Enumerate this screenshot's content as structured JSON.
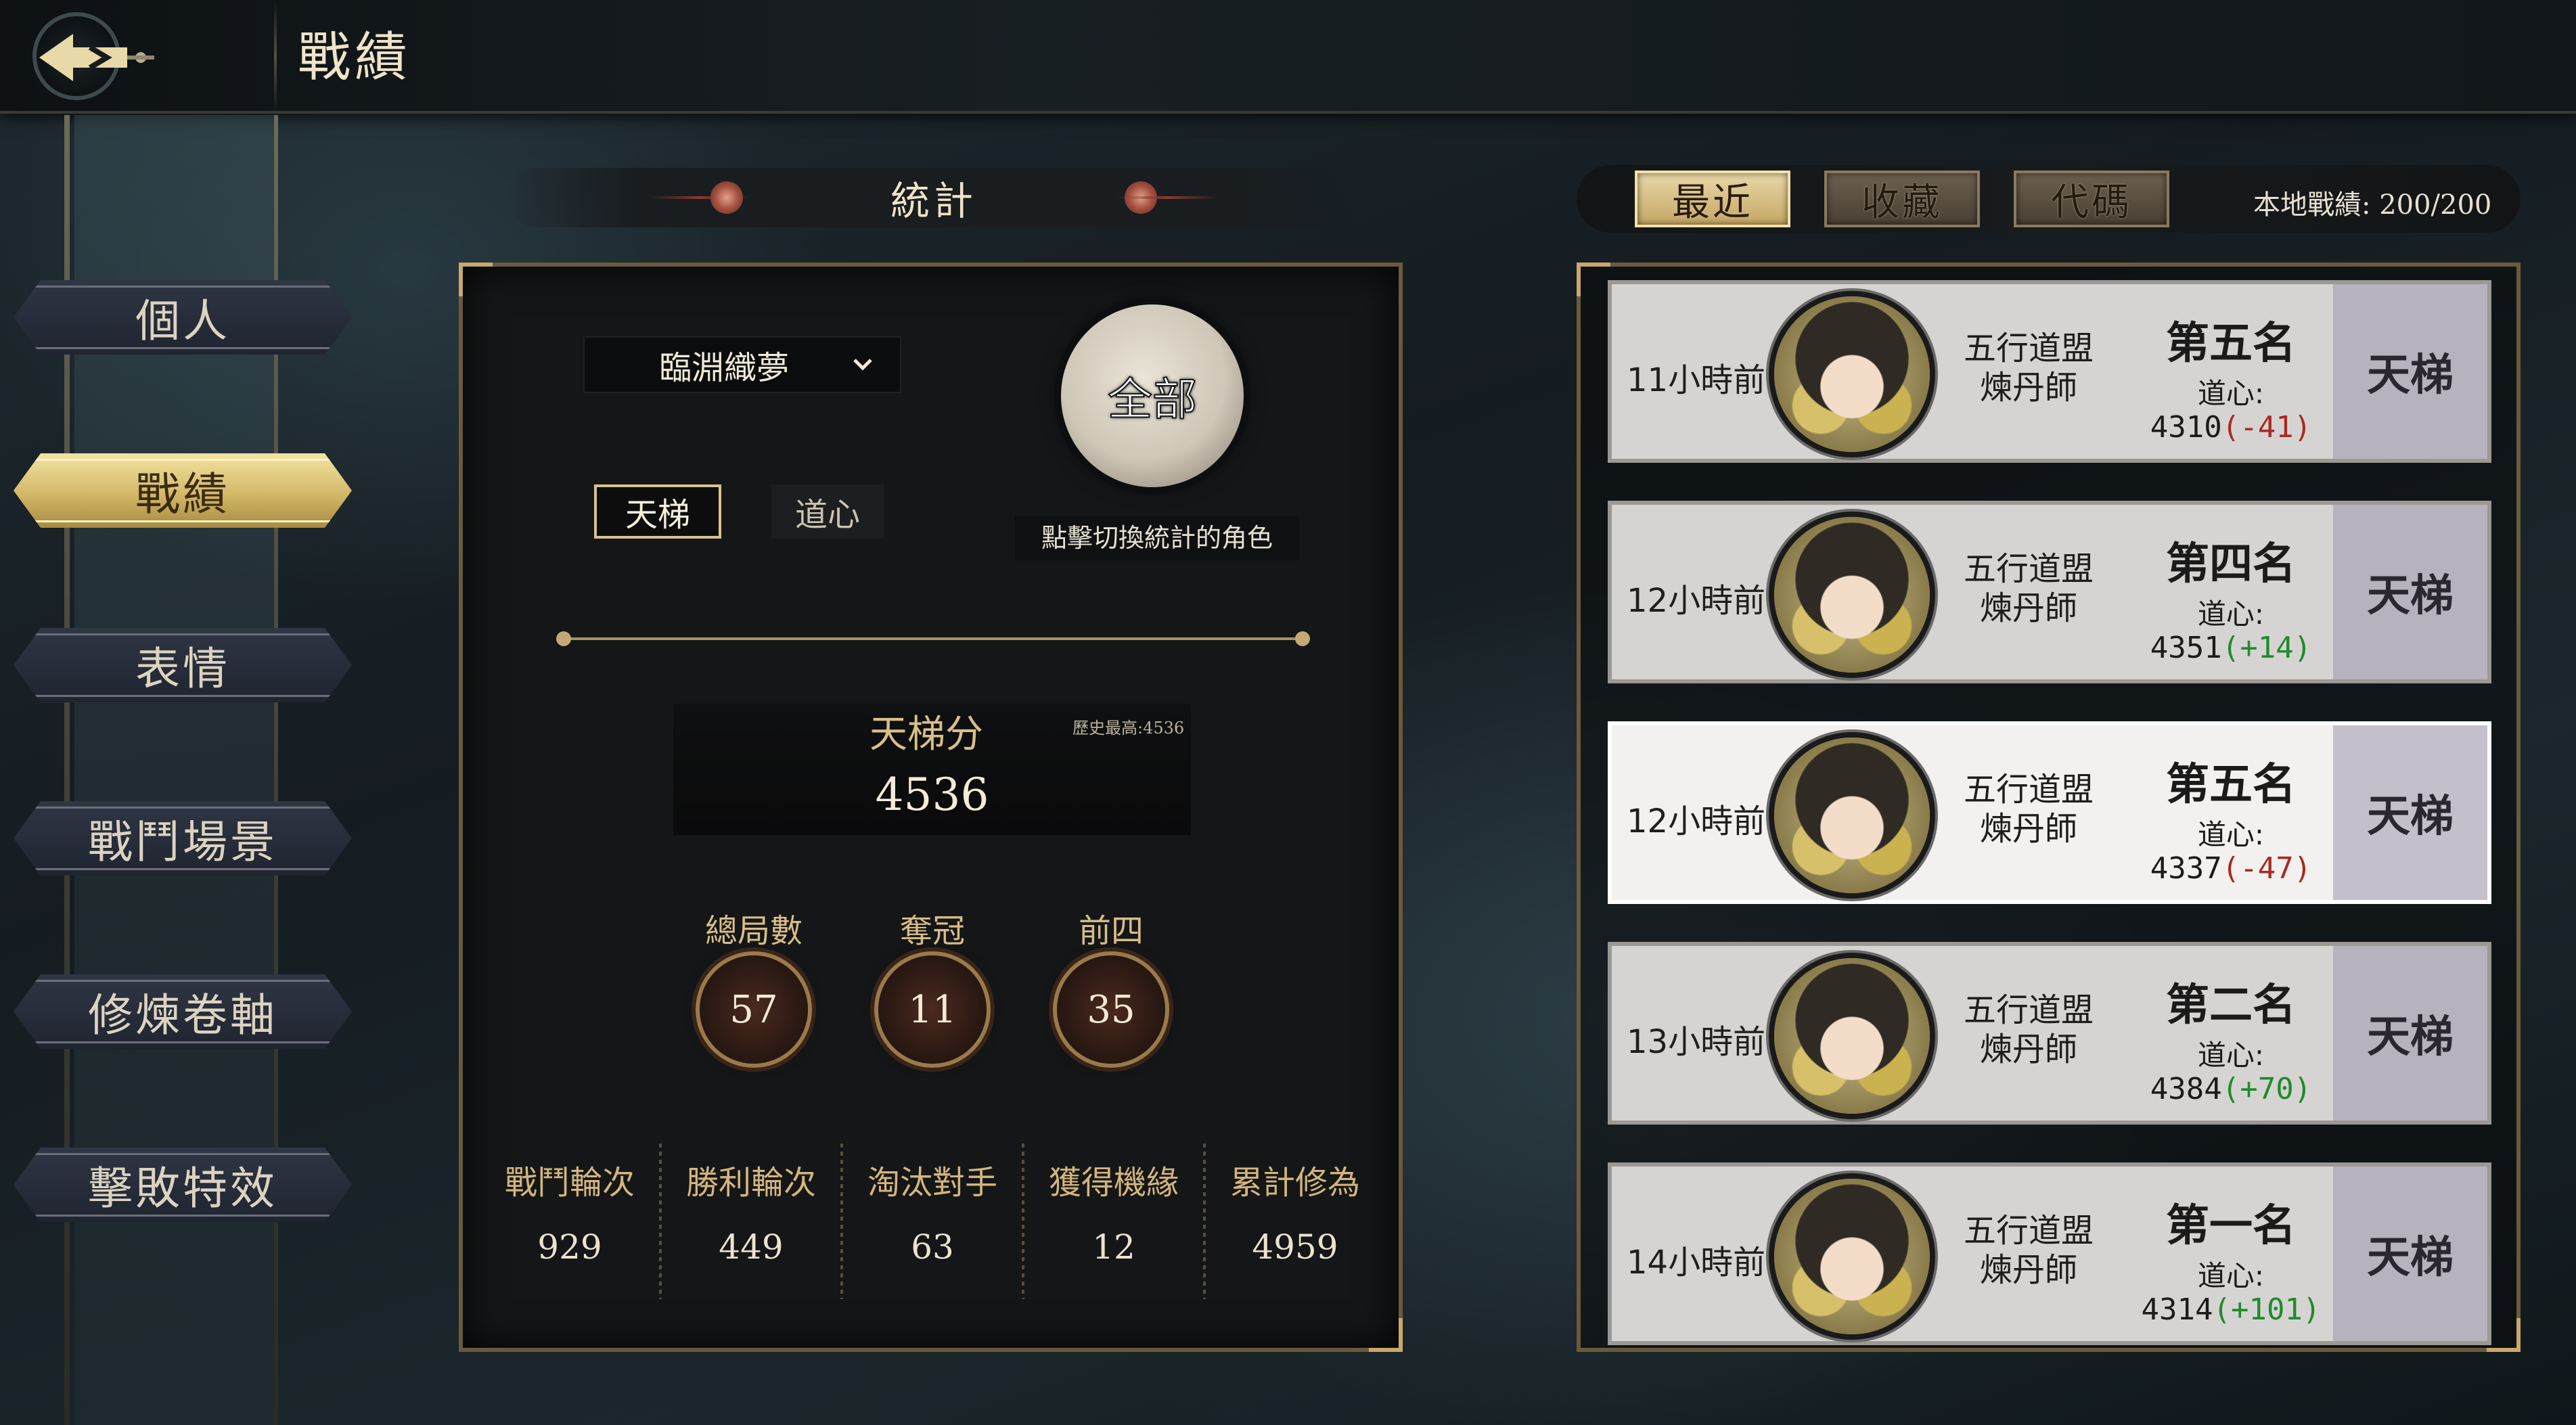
{
  "header": {
    "title": "戰績"
  },
  "sidebar": {
    "items": [
      {
        "label": "個人",
        "active": false
      },
      {
        "label": "戰績",
        "active": true
      },
      {
        "label": "表情",
        "active": false
      },
      {
        "label": "戰鬥場景",
        "active": false
      },
      {
        "label": "修煉卷軸",
        "active": false
      },
      {
        "label": "擊敗特效",
        "active": false
      }
    ]
  },
  "stats": {
    "header": "統計",
    "character_select": "臨淵織夢",
    "all_button": "全部",
    "hint": "點擊切換統計的角色",
    "mode_tabs": [
      "天梯",
      "道心"
    ],
    "ladder": {
      "label": "天梯分",
      "history_best": "歷史最高:4536",
      "value": "4536"
    },
    "medals": [
      {
        "label": "總局數",
        "value": "57"
      },
      {
        "label": "奪冠",
        "value": "11"
      },
      {
        "label": "前四",
        "value": "35"
      }
    ],
    "columns": [
      {
        "label": "戰鬥輪次",
        "value": "929"
      },
      {
        "label": "勝利輪次",
        "value": "449"
      },
      {
        "label": "淘汰對手",
        "value": "63"
      },
      {
        "label": "獲得機緣",
        "value": "12"
      },
      {
        "label": "累計修為",
        "value": "4959"
      }
    ]
  },
  "history": {
    "tabs": [
      "最近",
      "收藏",
      "代碼"
    ],
    "local_count": "本地戰績: 200/200",
    "rows": [
      {
        "time": "11小時前",
        "guild1": "五行道盟",
        "guild2": "煉丹師",
        "rank": "第五名",
        "dx_label": "道心:",
        "score": "4310",
        "delta": "(-41)",
        "delta_sign": "neg",
        "mode": "天梯"
      },
      {
        "time": "12小時前",
        "guild1": "五行道盟",
        "guild2": "煉丹師",
        "rank": "第四名",
        "dx_label": "道心:",
        "score": "4351",
        "delta": "(+14)",
        "delta_sign": "pos",
        "mode": "天梯"
      },
      {
        "time": "12小時前",
        "guild1": "五行道盟",
        "guild2": "煉丹師",
        "rank": "第五名",
        "dx_label": "道心:",
        "score": "4337",
        "delta": "(-47)",
        "delta_sign": "neg",
        "mode": "天梯"
      },
      {
        "time": "13小時前",
        "guild1": "五行道盟",
        "guild2": "煉丹師",
        "rank": "第二名",
        "dx_label": "道心:",
        "score": "4384",
        "delta": "(+70)",
        "delta_sign": "pos",
        "mode": "天梯"
      },
      {
        "time": "14小時前",
        "guild1": "五行道盟",
        "guild2": "煉丹師",
        "rank": "第一名",
        "dx_label": "道心:",
        "score": "4314",
        "delta": "(+101)",
        "delta_sign": "pos",
        "mode": "天梯"
      }
    ]
  },
  "colors": {
    "accent_gold": "#d4b868",
    "negative": "#a82a22",
    "positive": "#1f8b2a"
  }
}
